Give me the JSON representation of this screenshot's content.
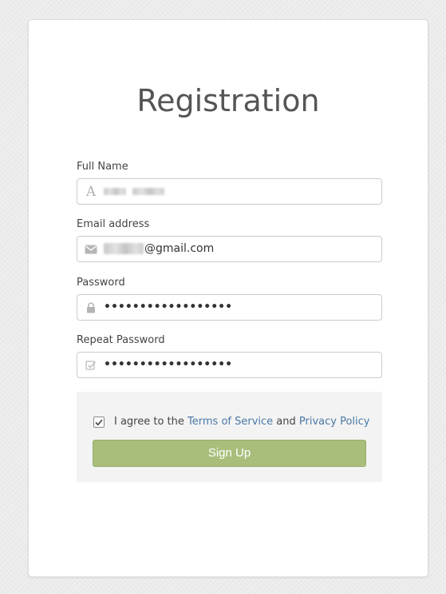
{
  "form": {
    "title": "Registration",
    "full_name": {
      "label": "Full Name",
      "icon": "font-letter-icon"
    },
    "email": {
      "label": "Email address",
      "icon": "envelope-icon",
      "value_visible": "@gmail.com"
    },
    "password": {
      "label": "Password",
      "icon": "lock-icon",
      "value": "••••••••••••••••••"
    },
    "repeat_password": {
      "label": "Repeat Password",
      "icon": "check-square-icon",
      "value": "••••••••••••••••••"
    },
    "agreement": {
      "checked": true,
      "prefix": "I agree to the",
      "terms_link": "Terms of Service",
      "conjunction": "and",
      "privacy_link": "Privacy Policy"
    },
    "submit_label": "Sign Up"
  },
  "colors": {
    "button": "#a9be7b",
    "link": "#4a78a6",
    "panel": "#f3f3f3"
  }
}
